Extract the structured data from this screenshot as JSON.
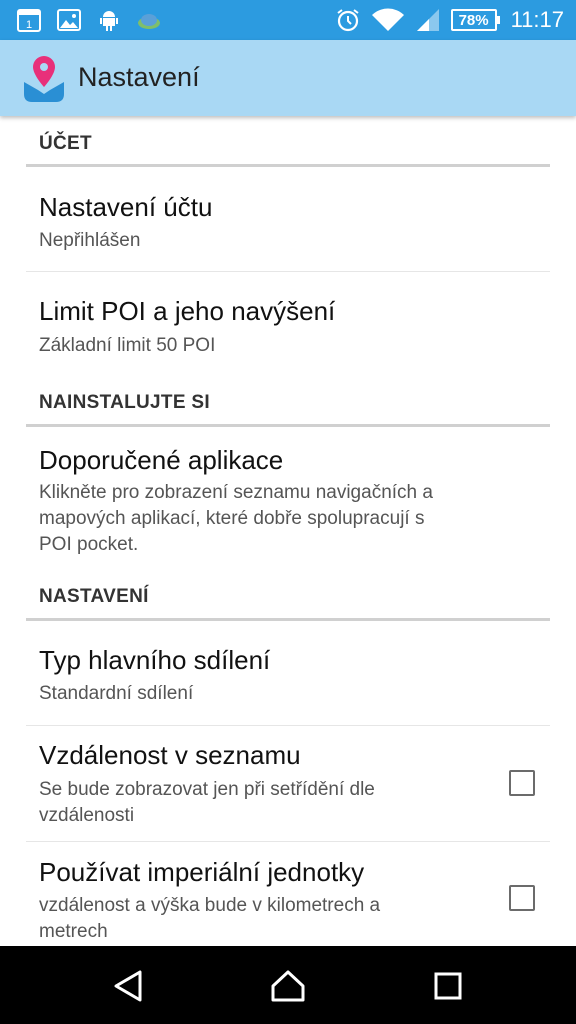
{
  "status_bar": {
    "icons_left": [
      "calendar-icon",
      "image-icon",
      "android-debug-icon",
      "app-notification-icon"
    ],
    "calendar_day": "1",
    "icons_right": [
      "alarm-icon",
      "wifi-icon",
      "signal-icon"
    ],
    "battery": "78%",
    "time": "11:17"
  },
  "app_bar": {
    "title": "Nastavení",
    "colors": {
      "background": "#a9d8f4",
      "status_bar": "#2c9be0"
    }
  },
  "sections": [
    {
      "header": "ÚČET",
      "items": [
        {
          "title": "Nastavení účtu",
          "summary": "Nepřihlášen"
        },
        {
          "title": "Limit POI a jeho navýšení",
          "summary": "Základní limit 50 POI"
        }
      ]
    },
    {
      "header": "NAINSTALUJTE SI",
      "items": [
        {
          "title": "Doporučené aplikace",
          "summary_lines": [
            "Klikněte pro zobrazení seznamu navigačních a",
            "mapových aplikací, které dobře spolupracují s",
            "POI pocket."
          ]
        }
      ]
    },
    {
      "header": "NASTAVENÍ",
      "items": [
        {
          "title": "Typ hlavního sdílení",
          "summary": "Standardní sdílení"
        },
        {
          "title": "Vzdálenost v seznamu",
          "summary_lines": [
            "Se bude zobrazovat jen při setřídění dle",
            "vzdálenosti"
          ],
          "checked": false
        },
        {
          "title": "Používat imperiální jednotky",
          "summary_lines": [
            "vzdálenost a výška bude v kilometrech a",
            "metrech"
          ],
          "checked": false
        }
      ]
    }
  ],
  "nav_bar": {
    "buttons": [
      "back-icon",
      "home-icon",
      "recents-icon"
    ]
  }
}
